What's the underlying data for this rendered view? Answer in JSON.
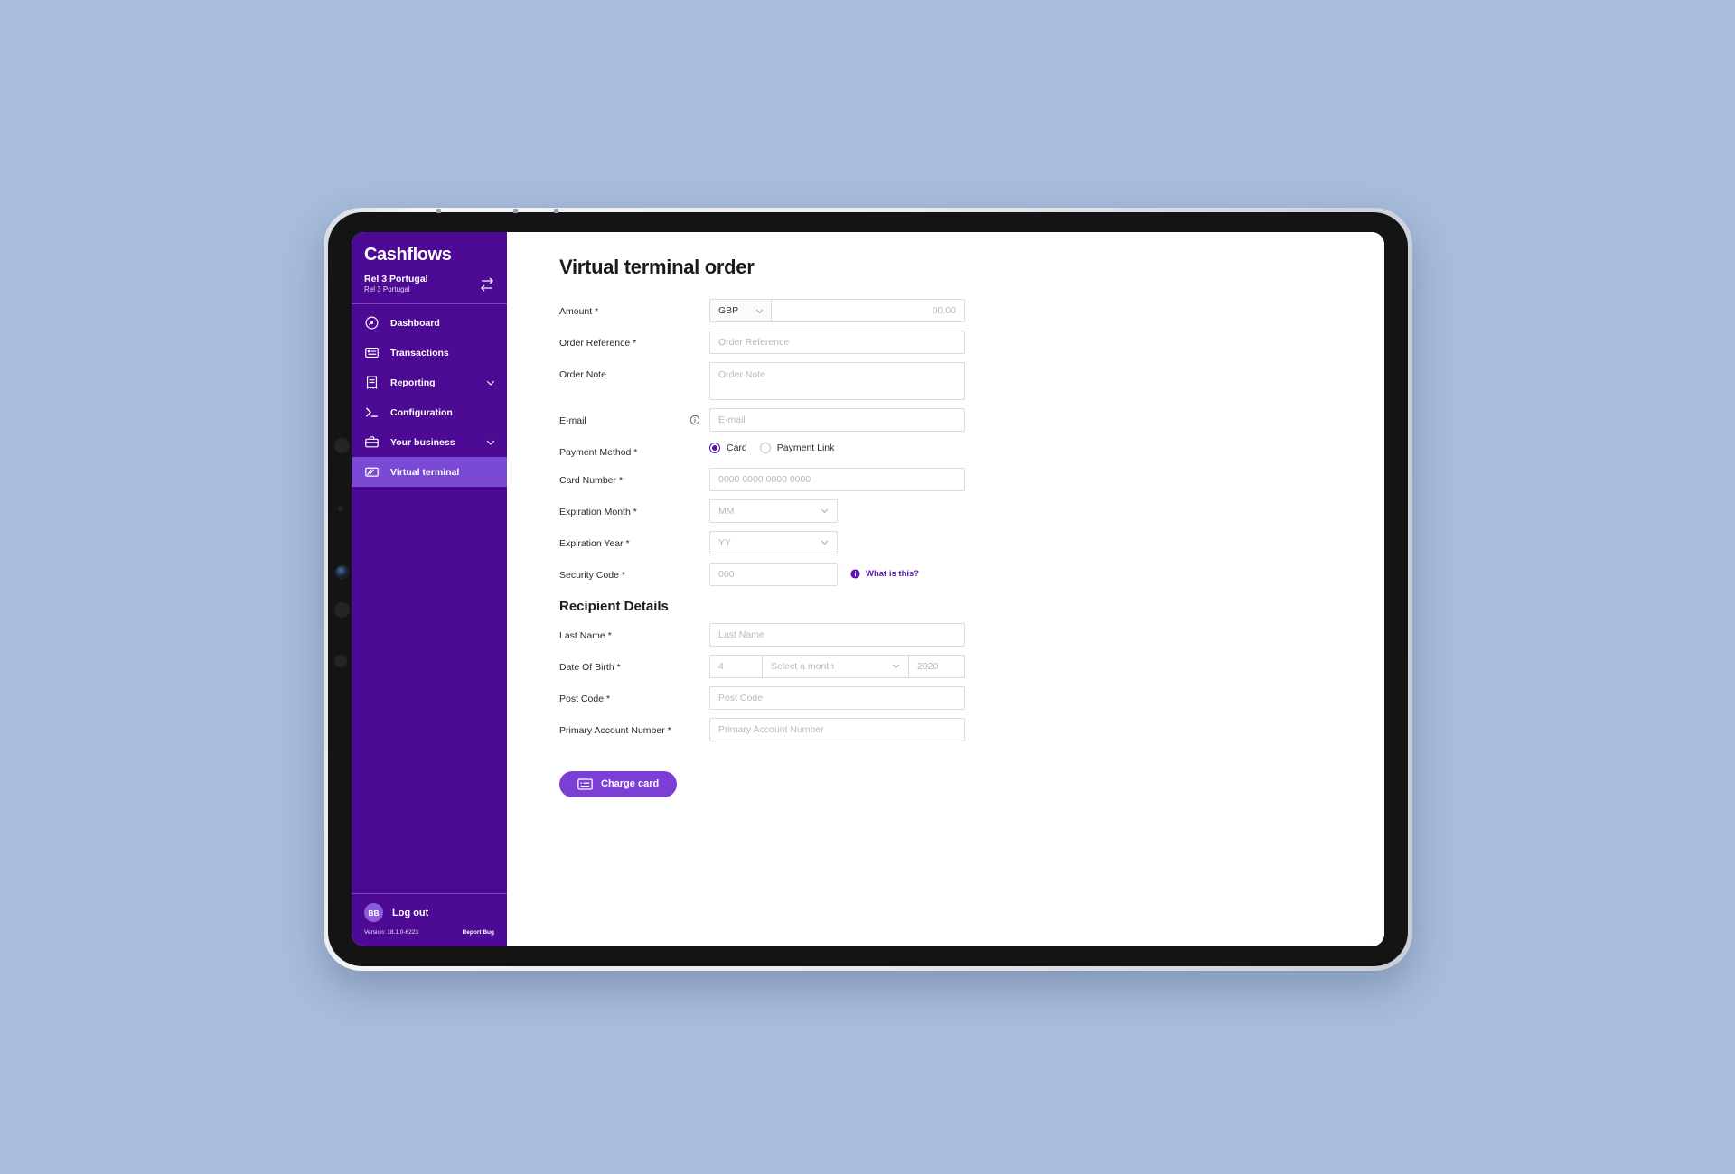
{
  "sidebar": {
    "brand": "Cashflows",
    "org": {
      "primary": "Rel 3 Portugal",
      "secondary": "Rel 3 Portugal",
      "switch_icon": "swap-arrows-icon"
    },
    "nav": [
      {
        "label": "Dashboard",
        "icon": "gauge-icon",
        "active": false,
        "chevron": false
      },
      {
        "label": "Transactions",
        "icon": "card-list-icon",
        "active": false,
        "chevron": false
      },
      {
        "label": "Reporting",
        "icon": "receipt-icon",
        "active": false,
        "chevron": true
      },
      {
        "label": "Configuration",
        "icon": "terminal-icon",
        "active": false,
        "chevron": false
      },
      {
        "label": "Your business",
        "icon": "briefcase-icon",
        "active": false,
        "chevron": true
      },
      {
        "label": "Virtual terminal",
        "icon": "terminal-pos-icon",
        "active": true,
        "chevron": false
      }
    ],
    "footer": {
      "avatar_initials": "BB",
      "logout_label": "Log out",
      "version": "Version: 18.1.0-6223",
      "report_bug_label": "Report Bug"
    },
    "colors": {
      "background": "#4d0a94",
      "active_item": "#7a4ad4",
      "avatar": "#8b5cdb"
    }
  },
  "main": {
    "page_title": "Virtual terminal order",
    "fields": {
      "amount": {
        "label": "Amount *",
        "currency_value": "GBP",
        "currency_options": [
          "GBP"
        ],
        "amount_placeholder": "00.00"
      },
      "order_reference": {
        "label": "Order Reference *",
        "placeholder": "Order Reference"
      },
      "order_note": {
        "label": "Order Note",
        "placeholder": "Order Note"
      },
      "email": {
        "label": "E-mail",
        "placeholder": "E-mail",
        "info_icon": "info-circle-icon"
      },
      "payment_method": {
        "label": "Payment Method *",
        "options": [
          {
            "label": "Card",
            "selected": true
          },
          {
            "label": "Payment Link",
            "selected": false
          }
        ]
      },
      "card_number": {
        "label": "Card Number *",
        "placeholder": "0000 0000 0000 0000"
      },
      "expiration_month": {
        "label": "Expiration Month *",
        "placeholder": "MM"
      },
      "expiration_year": {
        "label": "Expiration Year *",
        "placeholder": "YY"
      },
      "security_code": {
        "label": "Security Code *",
        "placeholder": "000",
        "help_link": "What is this?",
        "help_icon": "info-circle-filled-icon"
      }
    },
    "recipient": {
      "heading": "Recipient Details",
      "last_name": {
        "label": "Last Name *",
        "placeholder": "Last Name"
      },
      "date_of_birth": {
        "label": "Date Of Birth *",
        "day_placeholder": "4",
        "month_placeholder": "Select a month",
        "year_placeholder": "2020"
      },
      "post_code": {
        "label": "Post Code *",
        "placeholder": "Post Code"
      },
      "primary_account_number": {
        "label": "Primary Account Number *",
        "placeholder": "Primary Account Number"
      }
    },
    "submit": {
      "label": "Charge card",
      "icon": "card-icon",
      "color": "#7b3fd3"
    }
  }
}
